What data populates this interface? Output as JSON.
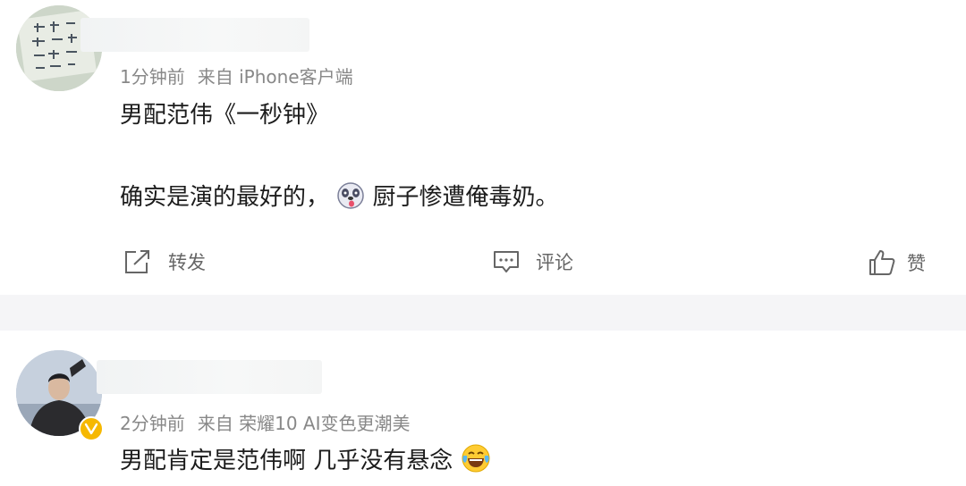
{
  "posts": [
    {
      "time": "1分钟前",
      "source": "来自 iPhone客户端",
      "line1": "男配范伟《一秒钟》",
      "line2_before": "确实是演的最好的，",
      "line2_after": "厨子惨遭俺毒奶。",
      "emoji": "dog-face-emoji",
      "actions": {
        "repost": "转发",
        "comment": "评论",
        "like": "赞"
      }
    },
    {
      "time": "2分钟前",
      "source": "来自 荣耀10 AI变色更潮美",
      "line1": "男配肯定是范伟啊 几乎没有悬念",
      "emoji": "laughing-tears-emoji",
      "badge": "verified-badge"
    }
  ]
}
